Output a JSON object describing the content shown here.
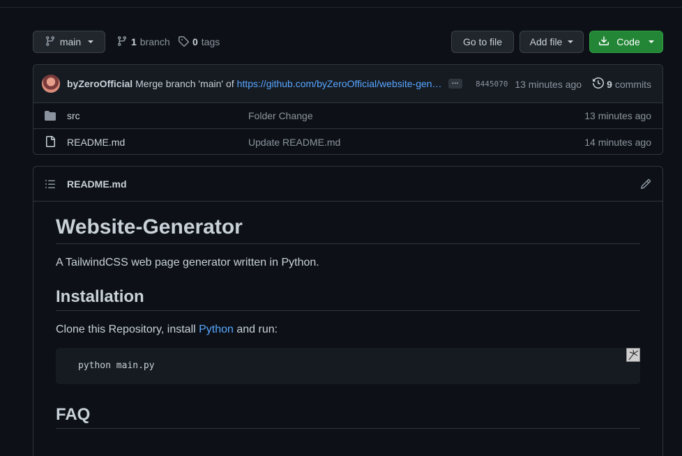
{
  "toolbar": {
    "branch_label": "main",
    "branch_count": "1",
    "branch_word": "branch",
    "tags_count": "0",
    "tags_word": "tags",
    "go_to_file": "Go to file",
    "add_file": "Add file",
    "code": "Code",
    "code_button_color": "#238636"
  },
  "commit": {
    "author": "byZeroOfficial",
    "message": "Merge branch 'main' of",
    "link": "https://github.com/byZeroOfficial/website-gen…",
    "ellipsis": "…",
    "sha": "8445070",
    "time": "13 minutes ago",
    "commits_count": "9",
    "commits_word": "commits"
  },
  "files": [
    {
      "name": "src",
      "icon": "folder-icon",
      "commit": "Folder Change",
      "age": "13 minutes ago"
    },
    {
      "name": "README.md",
      "icon": "file-icon",
      "commit": "Update README.md",
      "age": "14 minutes ago"
    }
  ],
  "readme": {
    "filename": "README.md",
    "title": "Website-Generator",
    "description": "A TailwindCSS web page generator written in Python.",
    "installation_heading": "Installation",
    "install_text_before": "Clone this Repository, install ",
    "install_link": "Python",
    "install_text_after": " and run:",
    "code": "python main.py",
    "faq_heading": "FAQ"
  },
  "colors": {
    "background": "#0d1117",
    "link": "#58a6ff",
    "border": "#30363d"
  }
}
